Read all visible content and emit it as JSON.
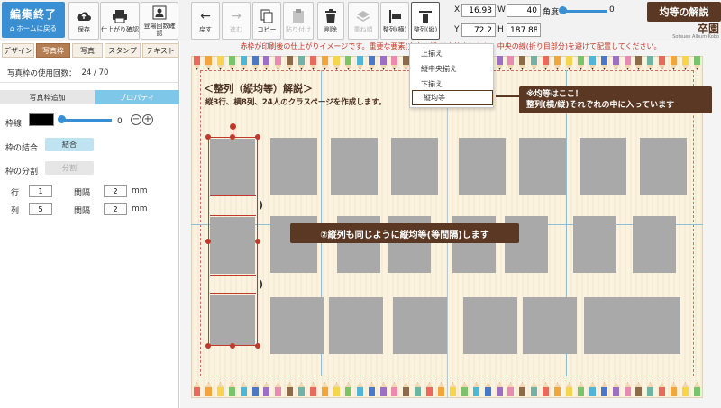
{
  "toolbar": {
    "home": {
      "title": "編集終了",
      "subtitle": "ホームに戻る"
    },
    "save": "保存",
    "preview": "仕上がり確認",
    "appearance_check": "登場回数確認",
    "undo": "戻す",
    "redo": "進む",
    "copy": "コピー",
    "paste": "貼り付け",
    "delete": "削除",
    "layer_order": "重ね順",
    "align_h": "整列(横)",
    "align_v": "整列(縦)",
    "x_label": "X",
    "x_value": "16.93",
    "w_label": "W",
    "w_value": "40",
    "angle_label": "角度",
    "angle_value": "0",
    "y_label": "Y",
    "y_value": "72.2",
    "h_label": "H",
    "h_value": "187.88"
  },
  "banner": {
    "title": "均等の解説",
    "logo_text": "卒園",
    "logo_sub": "Sotsuen Album Kobo"
  },
  "left_panel": {
    "tabs": [
      "デザイン",
      "写真枠",
      "写真",
      "スタンプ",
      "テキスト"
    ],
    "active_tab": 1,
    "usage_label": "写真枠の使用回数：",
    "usage_value": "24 / 70",
    "subtabs": [
      "写真枠追加",
      "プロパティ"
    ],
    "border_label": "枠線",
    "border_value": "0",
    "border_color": "#000000",
    "merge_label": "枠の結合",
    "merge_button": "結合",
    "split_label": "枠の分割",
    "split_button": "分割",
    "row_label": "行",
    "row_value": "1",
    "col_label": "列",
    "col_value": "5",
    "gap_label": "間隔",
    "gap_row_value": "2",
    "gap_col_value": "2",
    "unit": "mm"
  },
  "canvas": {
    "warning": "赤枠が印刷後の仕上がりイメージです。重要な要素(文字・顔)は赤枠内に入れ、中央の線(折り目部分)を避けて配置してください。",
    "heading": "＜整列（縦均等）解説＞",
    "subheading": "縦3行、横8列、24人のクラスページを作成します。"
  },
  "dropdown": {
    "items": [
      "上揃え",
      "縦中央揃え",
      "下揃え",
      "縦均等"
    ],
    "selected": 3
  },
  "callouts": {
    "top_line1": "※均等はここ！",
    "top_line2": "整列(横/縦)それぞれの中に入っています",
    "middle": "②縦列も同じように縦均等(等間隔)します"
  },
  "colors": {
    "accent_blue": "#3a8fd3",
    "tab_brown": "#b47e52",
    "callout_brown": "#5a3823",
    "selection_red": "#c0392b",
    "warning_red": "#c23a2a",
    "photo_gray": "#a9a9a9",
    "property_tab": "#7fc7e8"
  }
}
